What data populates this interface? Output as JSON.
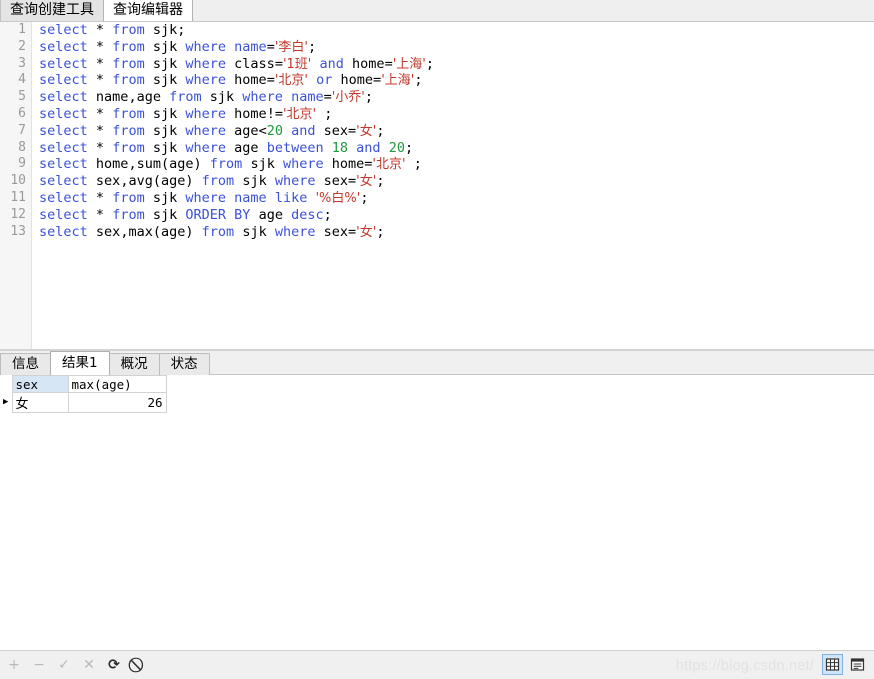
{
  "top_tabs": [
    {
      "label": "查询创建工具",
      "active": false
    },
    {
      "label": "查询编辑器",
      "active": true
    }
  ],
  "editor": {
    "line_numbers": [
      "1",
      "2",
      "3",
      "4",
      "5",
      "6",
      "7",
      "8",
      "9",
      "10",
      "11",
      "12",
      "13"
    ],
    "lines": [
      [
        {
          "t": "select",
          "c": "kw"
        },
        {
          "t": " ",
          "c": "op"
        },
        {
          "t": "*",
          "c": "op"
        },
        {
          "t": " ",
          "c": "op"
        },
        {
          "t": "from",
          "c": "kw"
        },
        {
          "t": " ",
          "c": "op"
        },
        {
          "t": "sjk",
          "c": "id"
        },
        {
          "t": ";",
          "c": "op"
        }
      ],
      [
        {
          "t": "select",
          "c": "kw"
        },
        {
          "t": " ",
          "c": "op"
        },
        {
          "t": "*",
          "c": "op"
        },
        {
          "t": " ",
          "c": "op"
        },
        {
          "t": "from",
          "c": "kw"
        },
        {
          "t": " ",
          "c": "op"
        },
        {
          "t": "sjk",
          "c": "id"
        },
        {
          "t": " ",
          "c": "op"
        },
        {
          "t": "where",
          "c": "kw"
        },
        {
          "t": " ",
          "c": "op"
        },
        {
          "t": "name",
          "c": "kw"
        },
        {
          "t": "=",
          "c": "op"
        },
        {
          "t": "'李白'",
          "c": "str"
        },
        {
          "t": ";",
          "c": "op"
        }
      ],
      [
        {
          "t": "select",
          "c": "kw"
        },
        {
          "t": " ",
          "c": "op"
        },
        {
          "t": "*",
          "c": "op"
        },
        {
          "t": " ",
          "c": "op"
        },
        {
          "t": "from",
          "c": "kw"
        },
        {
          "t": " ",
          "c": "op"
        },
        {
          "t": "sjk",
          "c": "id"
        },
        {
          "t": " ",
          "c": "op"
        },
        {
          "t": "where",
          "c": "kw"
        },
        {
          "t": " ",
          "c": "op"
        },
        {
          "t": "class",
          "c": "id"
        },
        {
          "t": "=",
          "c": "op"
        },
        {
          "t": "'1班'",
          "c": "str"
        },
        {
          "t": " ",
          "c": "op"
        },
        {
          "t": "and",
          "c": "kw"
        },
        {
          "t": " ",
          "c": "op"
        },
        {
          "t": "home",
          "c": "id"
        },
        {
          "t": "=",
          "c": "op"
        },
        {
          "t": "'上海'",
          "c": "str"
        },
        {
          "t": ";",
          "c": "op"
        }
      ],
      [
        {
          "t": "select",
          "c": "kw"
        },
        {
          "t": " ",
          "c": "op"
        },
        {
          "t": "*",
          "c": "op"
        },
        {
          "t": " ",
          "c": "op"
        },
        {
          "t": "from",
          "c": "kw"
        },
        {
          "t": " ",
          "c": "op"
        },
        {
          "t": "sjk",
          "c": "id"
        },
        {
          "t": " ",
          "c": "op"
        },
        {
          "t": "where",
          "c": "kw"
        },
        {
          "t": " ",
          "c": "op"
        },
        {
          "t": "home",
          "c": "id"
        },
        {
          "t": "=",
          "c": "op"
        },
        {
          "t": "'北京'",
          "c": "str"
        },
        {
          "t": " ",
          "c": "op"
        },
        {
          "t": "or",
          "c": "kw"
        },
        {
          "t": " ",
          "c": "op"
        },
        {
          "t": "home",
          "c": "id"
        },
        {
          "t": "=",
          "c": "op"
        },
        {
          "t": "'上海'",
          "c": "str"
        },
        {
          "t": ";",
          "c": "op"
        }
      ],
      [
        {
          "t": "select",
          "c": "kw"
        },
        {
          "t": " ",
          "c": "op"
        },
        {
          "t": "name",
          "c": "id"
        },
        {
          "t": ",",
          "c": "op"
        },
        {
          "t": "age",
          "c": "id"
        },
        {
          "t": " ",
          "c": "op"
        },
        {
          "t": "from",
          "c": "kw"
        },
        {
          "t": " ",
          "c": "op"
        },
        {
          "t": "sjk",
          "c": "id"
        },
        {
          "t": " ",
          "c": "op"
        },
        {
          "t": "where",
          "c": "kw"
        },
        {
          "t": " ",
          "c": "op"
        },
        {
          "t": "name",
          "c": "kw"
        },
        {
          "t": "=",
          "c": "op"
        },
        {
          "t": "'小乔'",
          "c": "str"
        },
        {
          "t": ";",
          "c": "op"
        }
      ],
      [
        {
          "t": "select",
          "c": "kw"
        },
        {
          "t": " ",
          "c": "op"
        },
        {
          "t": "*",
          "c": "op"
        },
        {
          "t": " ",
          "c": "op"
        },
        {
          "t": "from",
          "c": "kw"
        },
        {
          "t": " ",
          "c": "op"
        },
        {
          "t": "sjk",
          "c": "id"
        },
        {
          "t": " ",
          "c": "op"
        },
        {
          "t": "where",
          "c": "kw"
        },
        {
          "t": " ",
          "c": "op"
        },
        {
          "t": "home",
          "c": "id"
        },
        {
          "t": "!=",
          "c": "op"
        },
        {
          "t": "'北京'",
          "c": "str"
        },
        {
          "t": " ",
          "c": "op"
        },
        {
          "t": ";",
          "c": "op"
        }
      ],
      [
        {
          "t": "select",
          "c": "kw"
        },
        {
          "t": " ",
          "c": "op"
        },
        {
          "t": "*",
          "c": "op"
        },
        {
          "t": " ",
          "c": "op"
        },
        {
          "t": "from",
          "c": "kw"
        },
        {
          "t": " ",
          "c": "op"
        },
        {
          "t": "sjk",
          "c": "id"
        },
        {
          "t": " ",
          "c": "op"
        },
        {
          "t": "where",
          "c": "kw"
        },
        {
          "t": " ",
          "c": "op"
        },
        {
          "t": "age",
          "c": "id"
        },
        {
          "t": "<",
          "c": "op"
        },
        {
          "t": "20",
          "c": "num"
        },
        {
          "t": " ",
          "c": "op"
        },
        {
          "t": "and",
          "c": "kw"
        },
        {
          "t": " ",
          "c": "op"
        },
        {
          "t": "sex",
          "c": "id"
        },
        {
          "t": "=",
          "c": "op"
        },
        {
          "t": "'女'",
          "c": "str"
        },
        {
          "t": ";",
          "c": "op"
        }
      ],
      [
        {
          "t": "select",
          "c": "kw"
        },
        {
          "t": " ",
          "c": "op"
        },
        {
          "t": "*",
          "c": "op"
        },
        {
          "t": " ",
          "c": "op"
        },
        {
          "t": "from",
          "c": "kw"
        },
        {
          "t": " ",
          "c": "op"
        },
        {
          "t": "sjk",
          "c": "id"
        },
        {
          "t": " ",
          "c": "op"
        },
        {
          "t": "where",
          "c": "kw"
        },
        {
          "t": " ",
          "c": "op"
        },
        {
          "t": "age",
          "c": "id"
        },
        {
          "t": " ",
          "c": "op"
        },
        {
          "t": "between",
          "c": "kw"
        },
        {
          "t": " ",
          "c": "op"
        },
        {
          "t": "18",
          "c": "num"
        },
        {
          "t": " ",
          "c": "op"
        },
        {
          "t": "and",
          "c": "kw"
        },
        {
          "t": " ",
          "c": "op"
        },
        {
          "t": "20",
          "c": "num"
        },
        {
          "t": ";",
          "c": "op"
        }
      ],
      [
        {
          "t": "select",
          "c": "kw"
        },
        {
          "t": " ",
          "c": "op"
        },
        {
          "t": "home",
          "c": "id"
        },
        {
          "t": ",",
          "c": "op"
        },
        {
          "t": "sum",
          "c": "id"
        },
        {
          "t": "(",
          "c": "op"
        },
        {
          "t": "age",
          "c": "id"
        },
        {
          "t": ")",
          "c": "op"
        },
        {
          "t": " ",
          "c": "op"
        },
        {
          "t": "from",
          "c": "kw"
        },
        {
          "t": " ",
          "c": "op"
        },
        {
          "t": "sjk",
          "c": "id"
        },
        {
          "t": " ",
          "c": "op"
        },
        {
          "t": "where",
          "c": "kw"
        },
        {
          "t": " ",
          "c": "op"
        },
        {
          "t": "home",
          "c": "id"
        },
        {
          "t": "=",
          "c": "op"
        },
        {
          "t": "'北京'",
          "c": "str"
        },
        {
          "t": " ",
          "c": "op"
        },
        {
          "t": ";",
          "c": "op"
        }
      ],
      [
        {
          "t": "select",
          "c": "kw"
        },
        {
          "t": " ",
          "c": "op"
        },
        {
          "t": "sex",
          "c": "id"
        },
        {
          "t": ",",
          "c": "op"
        },
        {
          "t": "avg",
          "c": "id"
        },
        {
          "t": "(",
          "c": "op"
        },
        {
          "t": "age",
          "c": "id"
        },
        {
          "t": ")",
          "c": "op"
        },
        {
          "t": " ",
          "c": "op"
        },
        {
          "t": "from",
          "c": "kw"
        },
        {
          "t": " ",
          "c": "op"
        },
        {
          "t": "sjk",
          "c": "id"
        },
        {
          "t": " ",
          "c": "op"
        },
        {
          "t": "where",
          "c": "kw"
        },
        {
          "t": " ",
          "c": "op"
        },
        {
          "t": "sex",
          "c": "id"
        },
        {
          "t": "=",
          "c": "op"
        },
        {
          "t": "'女'",
          "c": "str"
        },
        {
          "t": ";",
          "c": "op"
        }
      ],
      [
        {
          "t": "select",
          "c": "kw"
        },
        {
          "t": " ",
          "c": "op"
        },
        {
          "t": "*",
          "c": "op"
        },
        {
          "t": " ",
          "c": "op"
        },
        {
          "t": "from",
          "c": "kw"
        },
        {
          "t": " ",
          "c": "op"
        },
        {
          "t": "sjk",
          "c": "id"
        },
        {
          "t": " ",
          "c": "op"
        },
        {
          "t": "where",
          "c": "kw"
        },
        {
          "t": " ",
          "c": "op"
        },
        {
          "t": "name",
          "c": "kw"
        },
        {
          "t": " ",
          "c": "op"
        },
        {
          "t": "like",
          "c": "kw"
        },
        {
          "t": " ",
          "c": "op"
        },
        {
          "t": "'%白%'",
          "c": "str"
        },
        {
          "t": ";",
          "c": "op"
        }
      ],
      [
        {
          "t": "select",
          "c": "kw"
        },
        {
          "t": " ",
          "c": "op"
        },
        {
          "t": "*",
          "c": "op"
        },
        {
          "t": " ",
          "c": "op"
        },
        {
          "t": "from",
          "c": "kw"
        },
        {
          "t": " ",
          "c": "op"
        },
        {
          "t": "sjk",
          "c": "id"
        },
        {
          "t": " ",
          "c": "op"
        },
        {
          "t": "ORDER",
          "c": "kw"
        },
        {
          "t": " ",
          "c": "op"
        },
        {
          "t": "BY",
          "c": "kw"
        },
        {
          "t": " ",
          "c": "op"
        },
        {
          "t": "age",
          "c": "id"
        },
        {
          "t": " ",
          "c": "op"
        },
        {
          "t": "desc",
          "c": "kw"
        },
        {
          "t": ";",
          "c": "op"
        }
      ],
      [
        {
          "t": "select",
          "c": "kw"
        },
        {
          "t": " ",
          "c": "op"
        },
        {
          "t": "sex",
          "c": "id"
        },
        {
          "t": ",",
          "c": "op"
        },
        {
          "t": "max",
          "c": "id"
        },
        {
          "t": "(",
          "c": "op"
        },
        {
          "t": "age",
          "c": "id"
        },
        {
          "t": ")",
          "c": "op"
        },
        {
          "t": " ",
          "c": "op"
        },
        {
          "t": "from",
          "c": "kw"
        },
        {
          "t": " ",
          "c": "op"
        },
        {
          "t": "sjk",
          "c": "id"
        },
        {
          "t": " ",
          "c": "op"
        },
        {
          "t": "where",
          "c": "kw"
        },
        {
          "t": " ",
          "c": "op"
        },
        {
          "t": "sex",
          "c": "id"
        },
        {
          "t": "=",
          "c": "op"
        },
        {
          "t": "'女'",
          "c": "str"
        },
        {
          "t": ";",
          "c": "op"
        }
      ]
    ],
    "colors": {
      "keyword": "#3b52d8",
      "string": "#c0392b",
      "number": "#1f9a3c",
      "identifier": "#000000",
      "line_number": "#9a9a9a"
    }
  },
  "result_tabs": [
    {
      "label": "信息",
      "active": false
    },
    {
      "label": "结果1",
      "active": true
    },
    {
      "label": "概况",
      "active": false
    },
    {
      "label": "状态",
      "active": false
    }
  ],
  "result_grid": {
    "columns": [
      "sex",
      "max(age)"
    ],
    "rows": [
      {
        "marker": "▶",
        "cells": [
          "女",
          "26"
        ]
      }
    ],
    "selected_column": "sex",
    "selected_column_color": "#d6e6f5"
  },
  "bottom_toolbar": {
    "buttons": [
      {
        "name": "add-record-button",
        "glyph": "+",
        "enabled": false
      },
      {
        "name": "delete-record-button",
        "glyph": "−",
        "enabled": false
      },
      {
        "name": "apply-change-button",
        "glyph": "✓",
        "enabled": false
      },
      {
        "name": "cancel-change-button",
        "glyph": "✕",
        "enabled": false
      },
      {
        "name": "refresh-button",
        "glyph": "⟳",
        "enabled": true
      },
      {
        "name": "stop-button",
        "glyph": "⃠",
        "enabled": true
      }
    ],
    "watermark": "https://blog.csdn.net/",
    "view_modes": [
      {
        "name": "grid-view-button",
        "selected": true
      },
      {
        "name": "form-view-button",
        "selected": false
      }
    ]
  }
}
